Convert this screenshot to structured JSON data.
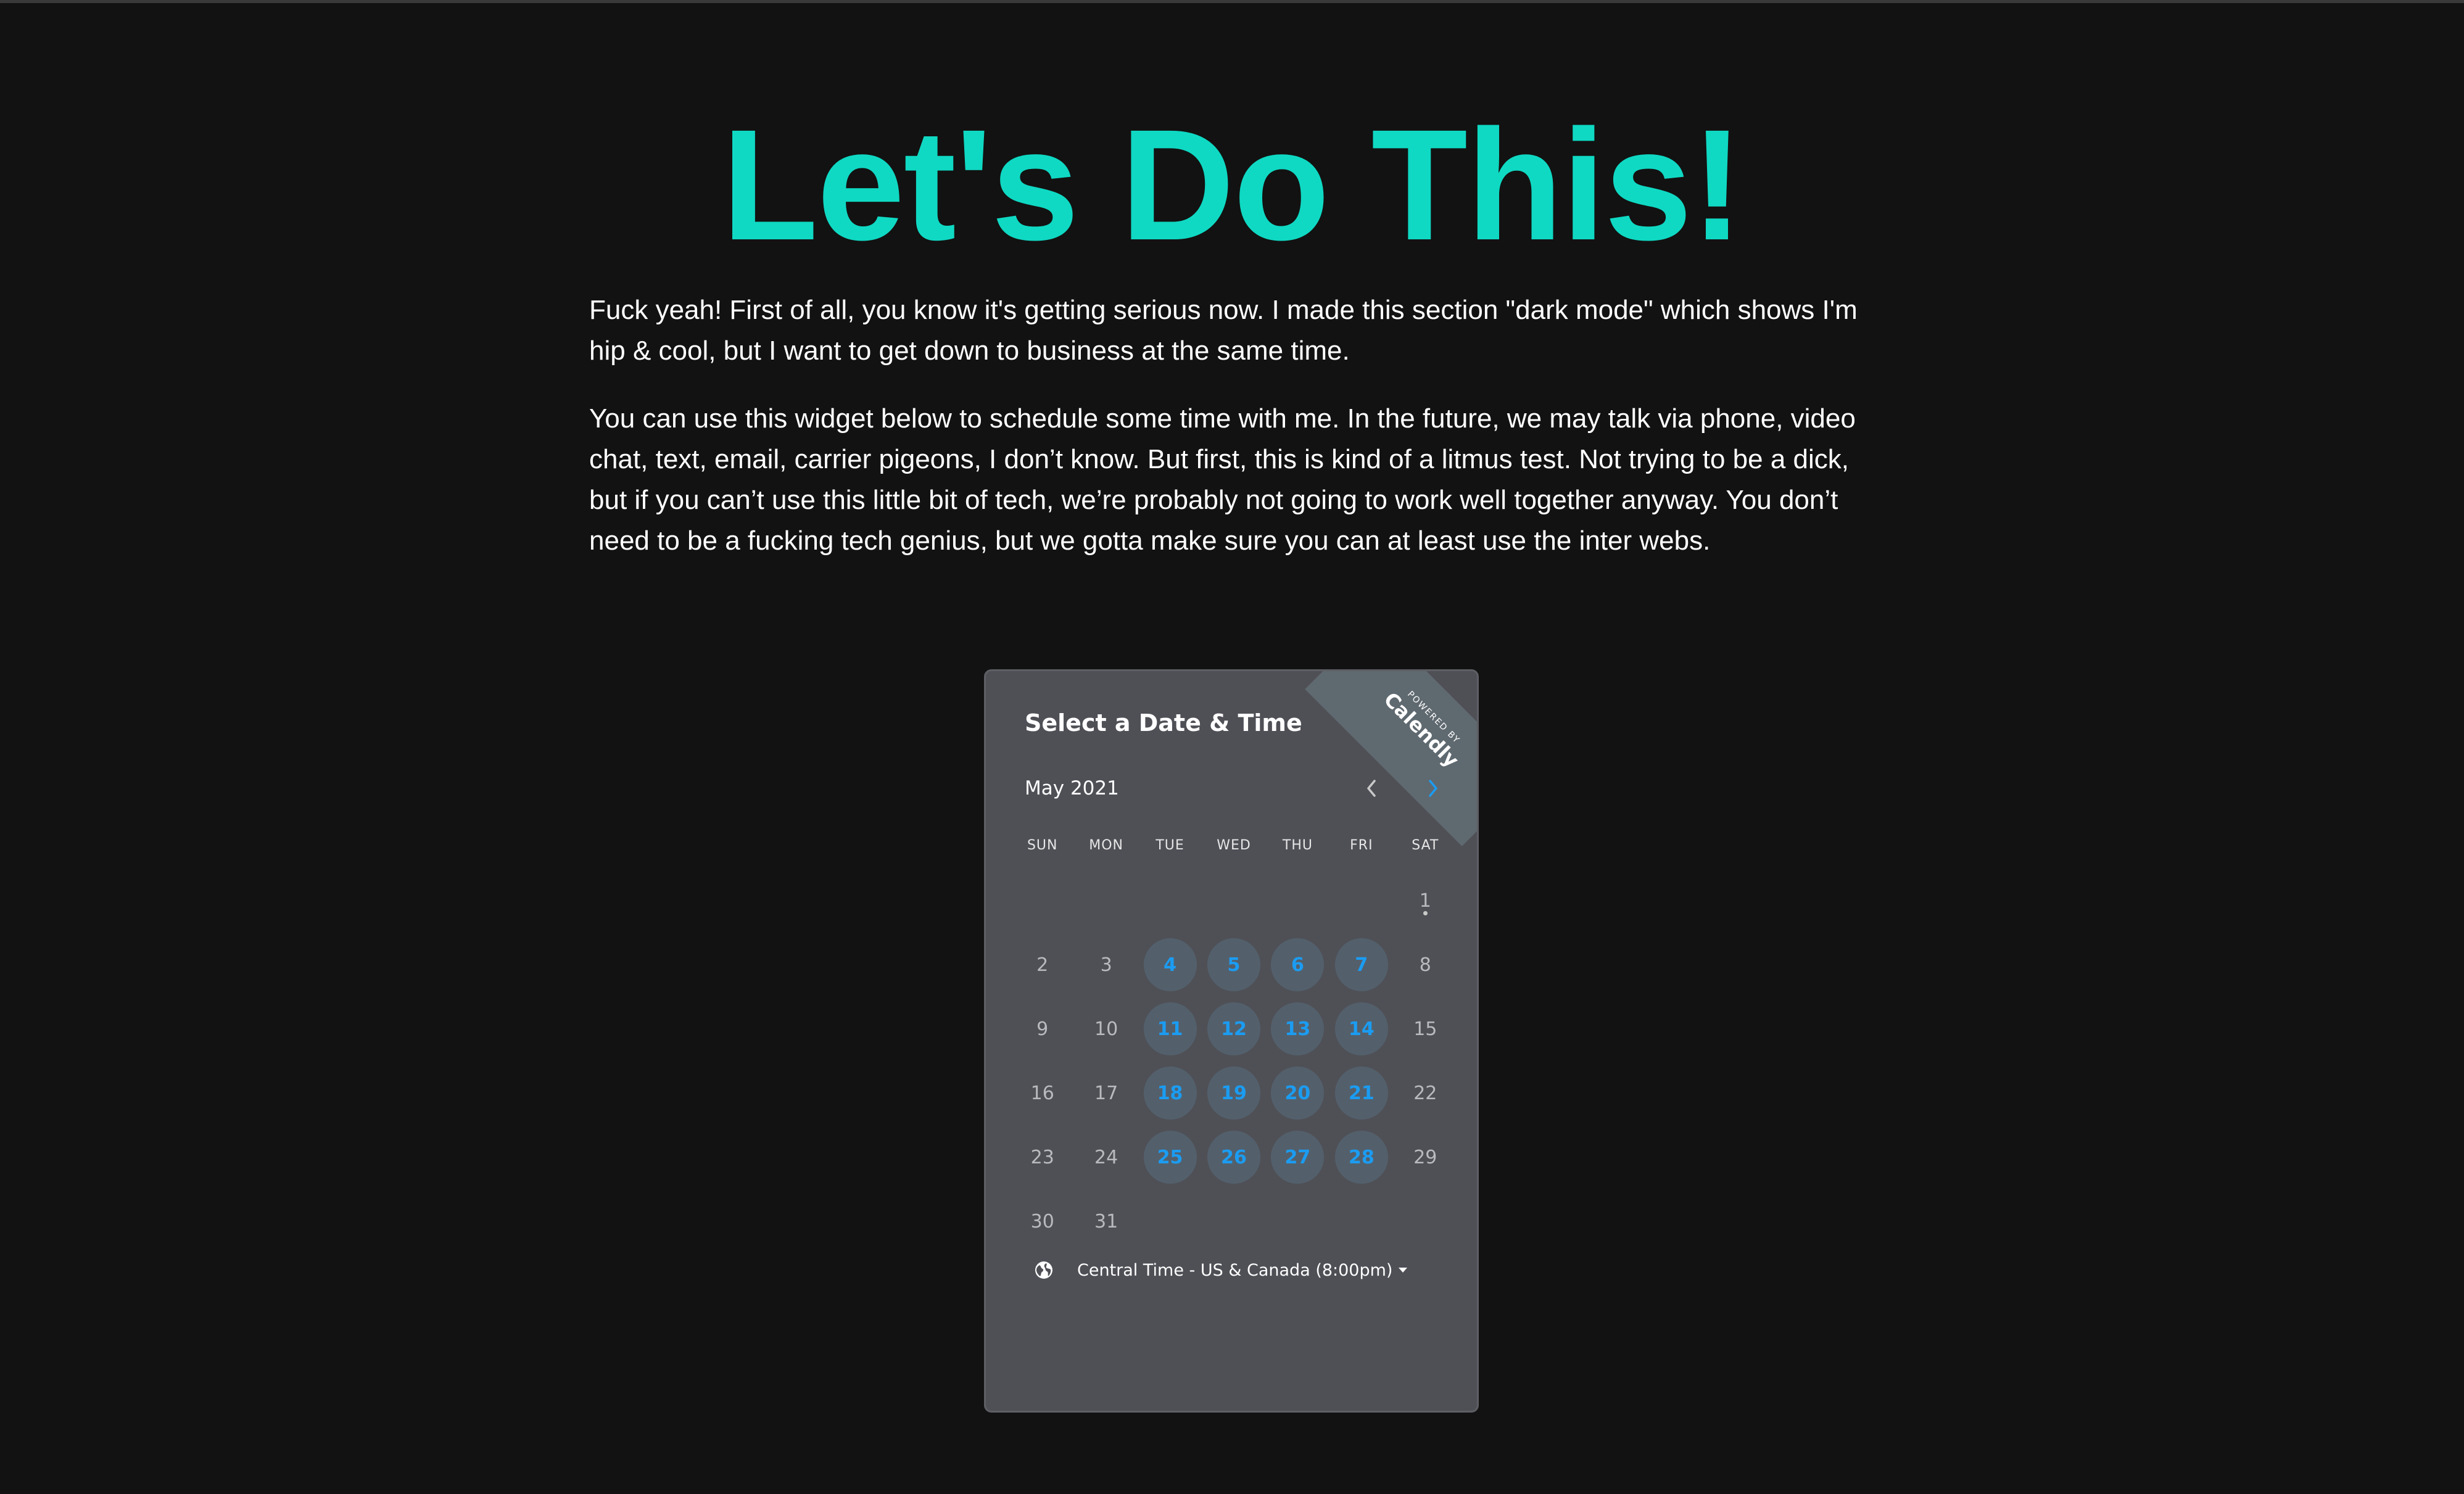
{
  "page": {
    "headline": "Let's Do This!",
    "paragraphs": [
      "Fuck yeah! First of all, you know it's getting serious now. I made this section \"dark mode\" which shows I'm hip & cool, but I want to get down to business at the same time.",
      "You can use this widget below to schedule some time with me. In the future, we may talk via phone, video chat, text, email, carrier pigeons, I don’t know. But first, this is kind of a litmus test. Not trying to be a dick, but if you can’t use this little bit of tech, we’re probably not going to work well together anyway. You don’t need to be a fucking tech genius, but we gotta make sure you can at least use the inter webs."
    ],
    "accent_color": "#0fd9c3"
  },
  "widget": {
    "title": "Select a Date & Time",
    "ribbon_top": "POWERED BY",
    "ribbon_brand": "Calendly",
    "month": "May 2021",
    "weekdays": [
      "SUN",
      "MON",
      "TUE",
      "WED",
      "THU",
      "FRI",
      "SAT"
    ],
    "leading_blanks": 6,
    "days": [
      {
        "n": "1",
        "available": false,
        "today": true
      },
      {
        "n": "2",
        "available": false
      },
      {
        "n": "3",
        "available": false
      },
      {
        "n": "4",
        "available": true
      },
      {
        "n": "5",
        "available": true
      },
      {
        "n": "6",
        "available": true
      },
      {
        "n": "7",
        "available": true
      },
      {
        "n": "8",
        "available": false
      },
      {
        "n": "9",
        "available": false
      },
      {
        "n": "10",
        "available": false
      },
      {
        "n": "11",
        "available": true
      },
      {
        "n": "12",
        "available": true
      },
      {
        "n": "13",
        "available": true
      },
      {
        "n": "14",
        "available": true
      },
      {
        "n": "15",
        "available": false
      },
      {
        "n": "16",
        "available": false
      },
      {
        "n": "17",
        "available": false
      },
      {
        "n": "18",
        "available": true
      },
      {
        "n": "19",
        "available": true
      },
      {
        "n": "20",
        "available": true
      },
      {
        "n": "21",
        "available": true
      },
      {
        "n": "22",
        "available": false
      },
      {
        "n": "23",
        "available": false
      },
      {
        "n": "24",
        "available": false
      },
      {
        "n": "25",
        "available": true
      },
      {
        "n": "26",
        "available": true
      },
      {
        "n": "27",
        "available": true
      },
      {
        "n": "28",
        "available": true
      },
      {
        "n": "29",
        "available": false
      },
      {
        "n": "30",
        "available": false
      },
      {
        "n": "31",
        "available": false
      }
    ],
    "timezone": "Central Time - US & Canada (8:00pm)",
    "icons": {
      "prev": "chevron-left-icon",
      "next": "chevron-right-icon",
      "timezone": "globe-icon"
    },
    "available_color": "#1b9cf2"
  }
}
